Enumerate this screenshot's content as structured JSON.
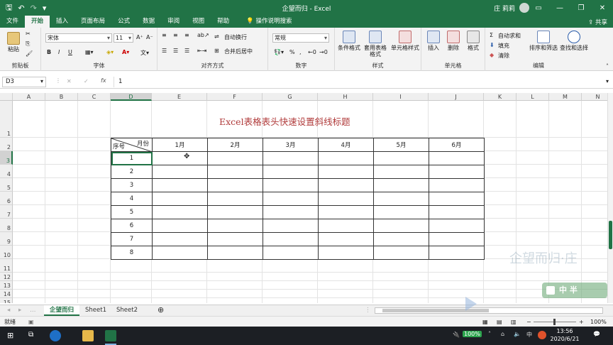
{
  "app": {
    "title": "企望而归 - Excel",
    "user": "庄 莉莉",
    "share": "共享"
  },
  "tabs": [
    "文件",
    "开始",
    "插入",
    "页面布局",
    "公式",
    "数据",
    "审阅",
    "视图",
    "帮助"
  ],
  "tab_search": "操作说明搜索",
  "ribbon": {
    "clipboard": {
      "label": "剪贴板",
      "paste": "粘贴"
    },
    "font": {
      "label": "字体",
      "name": "宋体",
      "size": "11",
      "bold": "B",
      "italic": "I",
      "underline": "U"
    },
    "alignment": {
      "label": "对齐方式",
      "wrap": "自动换行",
      "merge": "合并后居中"
    },
    "number": {
      "label": "数字",
      "format": "常规"
    },
    "styles": {
      "label": "样式",
      "conditional": "条件格式",
      "table": "套用表格格式",
      "cell": "单元格样式"
    },
    "cells": {
      "label": "单元格",
      "insert": "插入",
      "delete": "删除",
      "format": "格式"
    },
    "editing": {
      "label": "编辑",
      "autosum": "自动求和",
      "fill": "填充",
      "clear": "清除",
      "sort": "排序和筛选",
      "find": "查找和选择"
    }
  },
  "formula": {
    "namebox": "D3",
    "fx": "fx",
    "value": "1"
  },
  "columns": [
    "A",
    "B",
    "C",
    "D",
    "E",
    "F",
    "G",
    "H",
    "I",
    "J",
    "K",
    "L",
    "M",
    "N"
  ],
  "rows": [
    "1",
    "2",
    "3",
    "4",
    "5",
    "6",
    "7",
    "8",
    "9",
    "10",
    "11",
    "12",
    "13",
    "14",
    "15"
  ],
  "sheet": {
    "title": "Excel表格表头快速设置斜线标题",
    "diag_top": "月份",
    "diag_bottom": "序号",
    "months": [
      "1月",
      "2月",
      "3月",
      "4月",
      "5月",
      "6月"
    ],
    "ids": [
      "1",
      "2",
      "3",
      "4",
      "5",
      "6",
      "7",
      "8"
    ]
  },
  "sheet_tabs": [
    "企望而归",
    "Sheet1",
    "Sheet2"
  ],
  "status": {
    "ready": "就绪",
    "zoom": "100%"
  },
  "watermark": {
    "text1": "企望而归·庄",
    "badge": "中 半"
  },
  "taskbar": {
    "time": "13:56",
    "date": "2020/6/21",
    "battery": "100%",
    "ime": "中"
  },
  "colors": {
    "accent": "#217346",
    "title_text": "#b03a3a"
  }
}
